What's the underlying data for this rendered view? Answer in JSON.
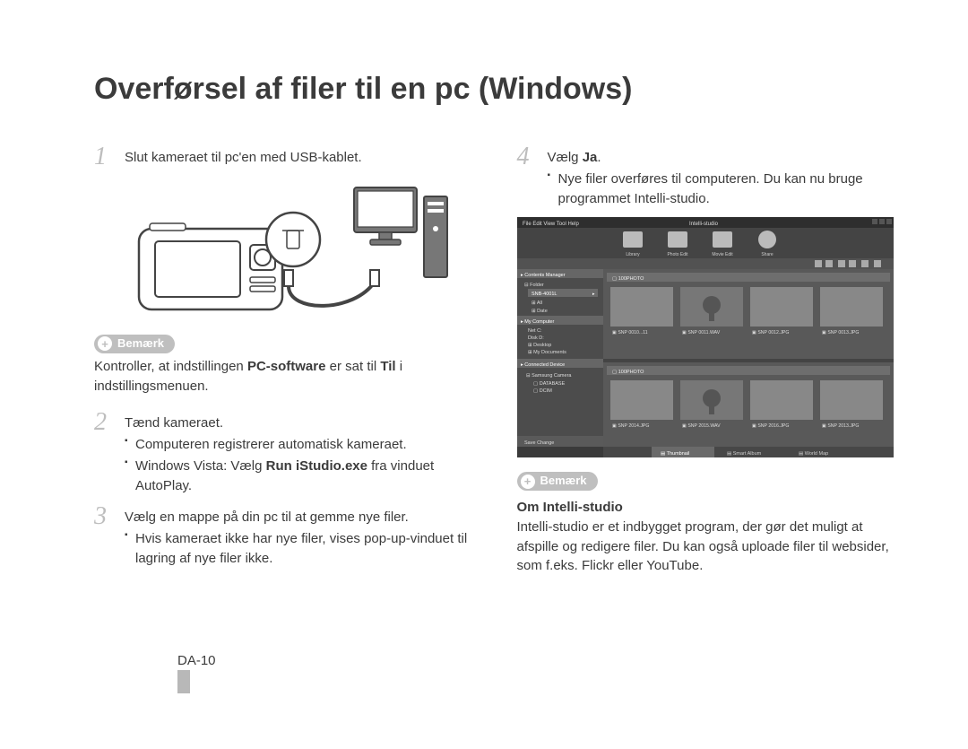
{
  "title": "Overførsel af filer til en pc (Windows)",
  "note_label": "Bemærk",
  "left": {
    "step1": {
      "num": "1",
      "text": "Slut kameraet til pc'en med USB-kablet."
    },
    "note_p1a": "Kontroller, at indstillingen ",
    "note_bold1": "PC-software",
    "note_p1b": " er sat til ",
    "note_bold2": "Til",
    "note_p1c": " i indstillingsmenuen.",
    "step2": {
      "num": "2",
      "text": "Tænd kameraet.",
      "b1": "Computeren registrerer automatisk kameraet.",
      "b2a": "Windows Vista: Vælg ",
      "b2bold": "Run iStudio.exe",
      "b2b": " fra vinduet AutoPlay."
    },
    "step3": {
      "num": "3",
      "text": "Vælg en mappe på din pc til at gemme nye filer.",
      "b1": "Hvis kameraet ikke har nye filer, vises pop-up-vinduet til lagring af nye filer ikke."
    }
  },
  "right": {
    "step4": {
      "num": "4",
      "texta": "Vælg ",
      "textbold": "Ja",
      "textb": ".",
      "b1": "Nye filer overføres til computeren. Du kan nu bruge programmet Intelli-studio."
    },
    "app": {
      "name": "Intelli-studio",
      "menu": [
        "File",
        "Edit",
        "View",
        "Tool",
        "Help"
      ],
      "tabs": [
        "Library",
        "Photo Edit",
        "Movie Edit",
        "Share"
      ],
      "panel1": "Contents Manager",
      "folder_root": "Folder",
      "folders": [
        "SNB-4001L",
        "All",
        "Date"
      ],
      "panel2": "My Computer",
      "drives": [
        "Net C:",
        "Disk D:",
        "Desktop",
        "My Documents"
      ],
      "panel3": "Connected Device",
      "device": "Samsung Camera",
      "dev_children": [
        "DATABASE",
        "DCIM"
      ],
      "path1": "100PHOTO",
      "path2": "100PHOTO",
      "thumbs_top": [
        "SNP 0010...11",
        "SNP 0011.WAV",
        "SNP 0012.JPG",
        "SNP 0013.JPG"
      ],
      "thumbs_bot": [
        "SNP 2014.JPG",
        "SNP 2015.WAV",
        "SNP 2016.JPG",
        "SNP 2013.JPG"
      ],
      "bottom_tabs": [
        "Thumbnail",
        "Smart Album",
        "World Map"
      ],
      "bottom_left": "Save Change"
    },
    "about_title": "Om Intelli-studio",
    "about_text": "Intelli-studio er et indbygget program, der gør det muligt at afspille og redigere filer. Du kan også uploade filer til websider, som f.eks. Flickr eller YouTube."
  },
  "footer": "DA-10"
}
